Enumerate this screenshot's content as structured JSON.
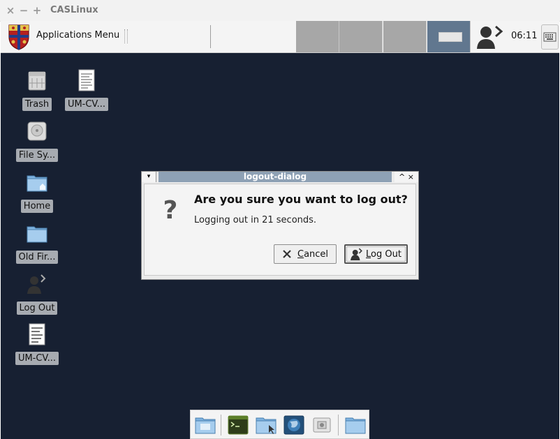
{
  "window": {
    "title": "CASLinux",
    "close": "×",
    "minimize": "−",
    "maximize": "+"
  },
  "panel": {
    "apps_menu_label": "Applications Menu",
    "workspaces": [
      "workspace-1",
      "workspace-2",
      "workspace-3",
      "workspace-4"
    ],
    "active_workspace": 4,
    "clock": "06:11",
    "icons": [
      "crest-logo-icon",
      "user-switch-icon",
      "keyboard-icon"
    ]
  },
  "desktop": {
    "icons": [
      {
        "label": "Trash",
        "icon": "trash-icon"
      },
      {
        "label": "UM-CV...",
        "icon": "document-icon"
      },
      {
        "label": "File Sy...",
        "icon": "harddisk-icon"
      },
      {
        "label": "Home",
        "icon": "home-folder-icon"
      },
      {
        "label": "Old Fir...",
        "icon": "folder-icon"
      },
      {
        "label": "Log Out",
        "icon": "logout-icon"
      },
      {
        "label": "UM-CV...",
        "icon": "document-icon"
      }
    ]
  },
  "dialog": {
    "title": "logout-dialog",
    "heading": "Are you sure you want to log out?",
    "message": "Logging out in 21 seconds.",
    "cancel_label": "Cancel",
    "logout_label": "Log Out",
    "menu_glyph": "▾",
    "controls": "^ ×"
  },
  "dock": {
    "items": [
      "file-manager-icon",
      "terminal-icon",
      "folder-search-icon",
      "web-browser-icon",
      "screenshot-icon",
      "folder-icon"
    ]
  },
  "colors": {
    "desktop_bg": "#172032",
    "active_workspace": "#61778f",
    "dialog_titlebar": "#8ea1b5"
  }
}
